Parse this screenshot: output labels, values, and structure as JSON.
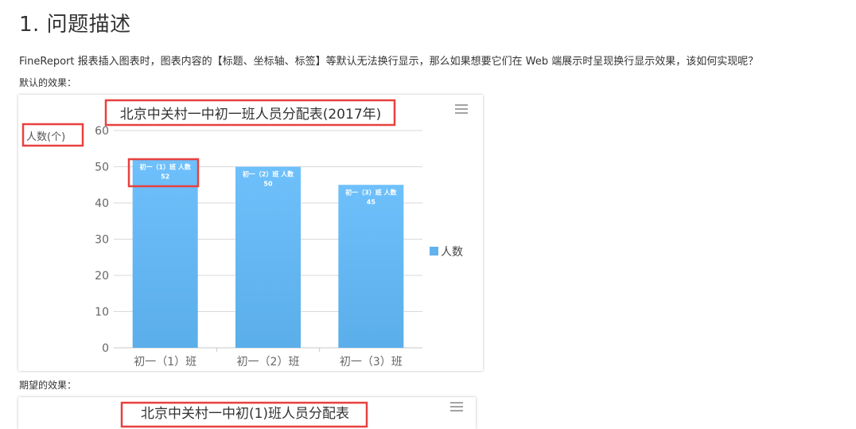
{
  "heading": "1. 问题描述",
  "description": "FineReport 报表插入图表时，图表内容的【标题、坐标轴、标签】等默认无法换行显示，那么如果想要它们在 Web 端展示时呈现换行显示效果，该如何实现呢？",
  "default_label": "默认的效果：",
  "expected_label": "期望的效果：",
  "expected_chart_title": "北京中关村一中初(1)班人员分配表",
  "icons": {
    "chart_menu": "hamburger-menu-icon"
  },
  "colors": {
    "bar_top": "#6ec0fb",
    "bar_bottom": "#5aaee9",
    "highlight_box": "#e8413f",
    "legend": "#62b2ee"
  },
  "chart_data": {
    "type": "bar",
    "title": "北京中关村一中初一班人员分配表(2017年)",
    "ylabel": "人数(个)",
    "xlabel": "",
    "categories": [
      "初一（1）班",
      "初一（2）班",
      "初一（3）班"
    ],
    "series": [
      {
        "name": "人数",
        "values": [
          52,
          50,
          45
        ]
      }
    ],
    "data_label_prefix": "人数",
    "ylim": [
      0,
      60
    ],
    "yticks": [
      0,
      10,
      20,
      30,
      40,
      50,
      60
    ],
    "grid": true,
    "legend": "right"
  }
}
